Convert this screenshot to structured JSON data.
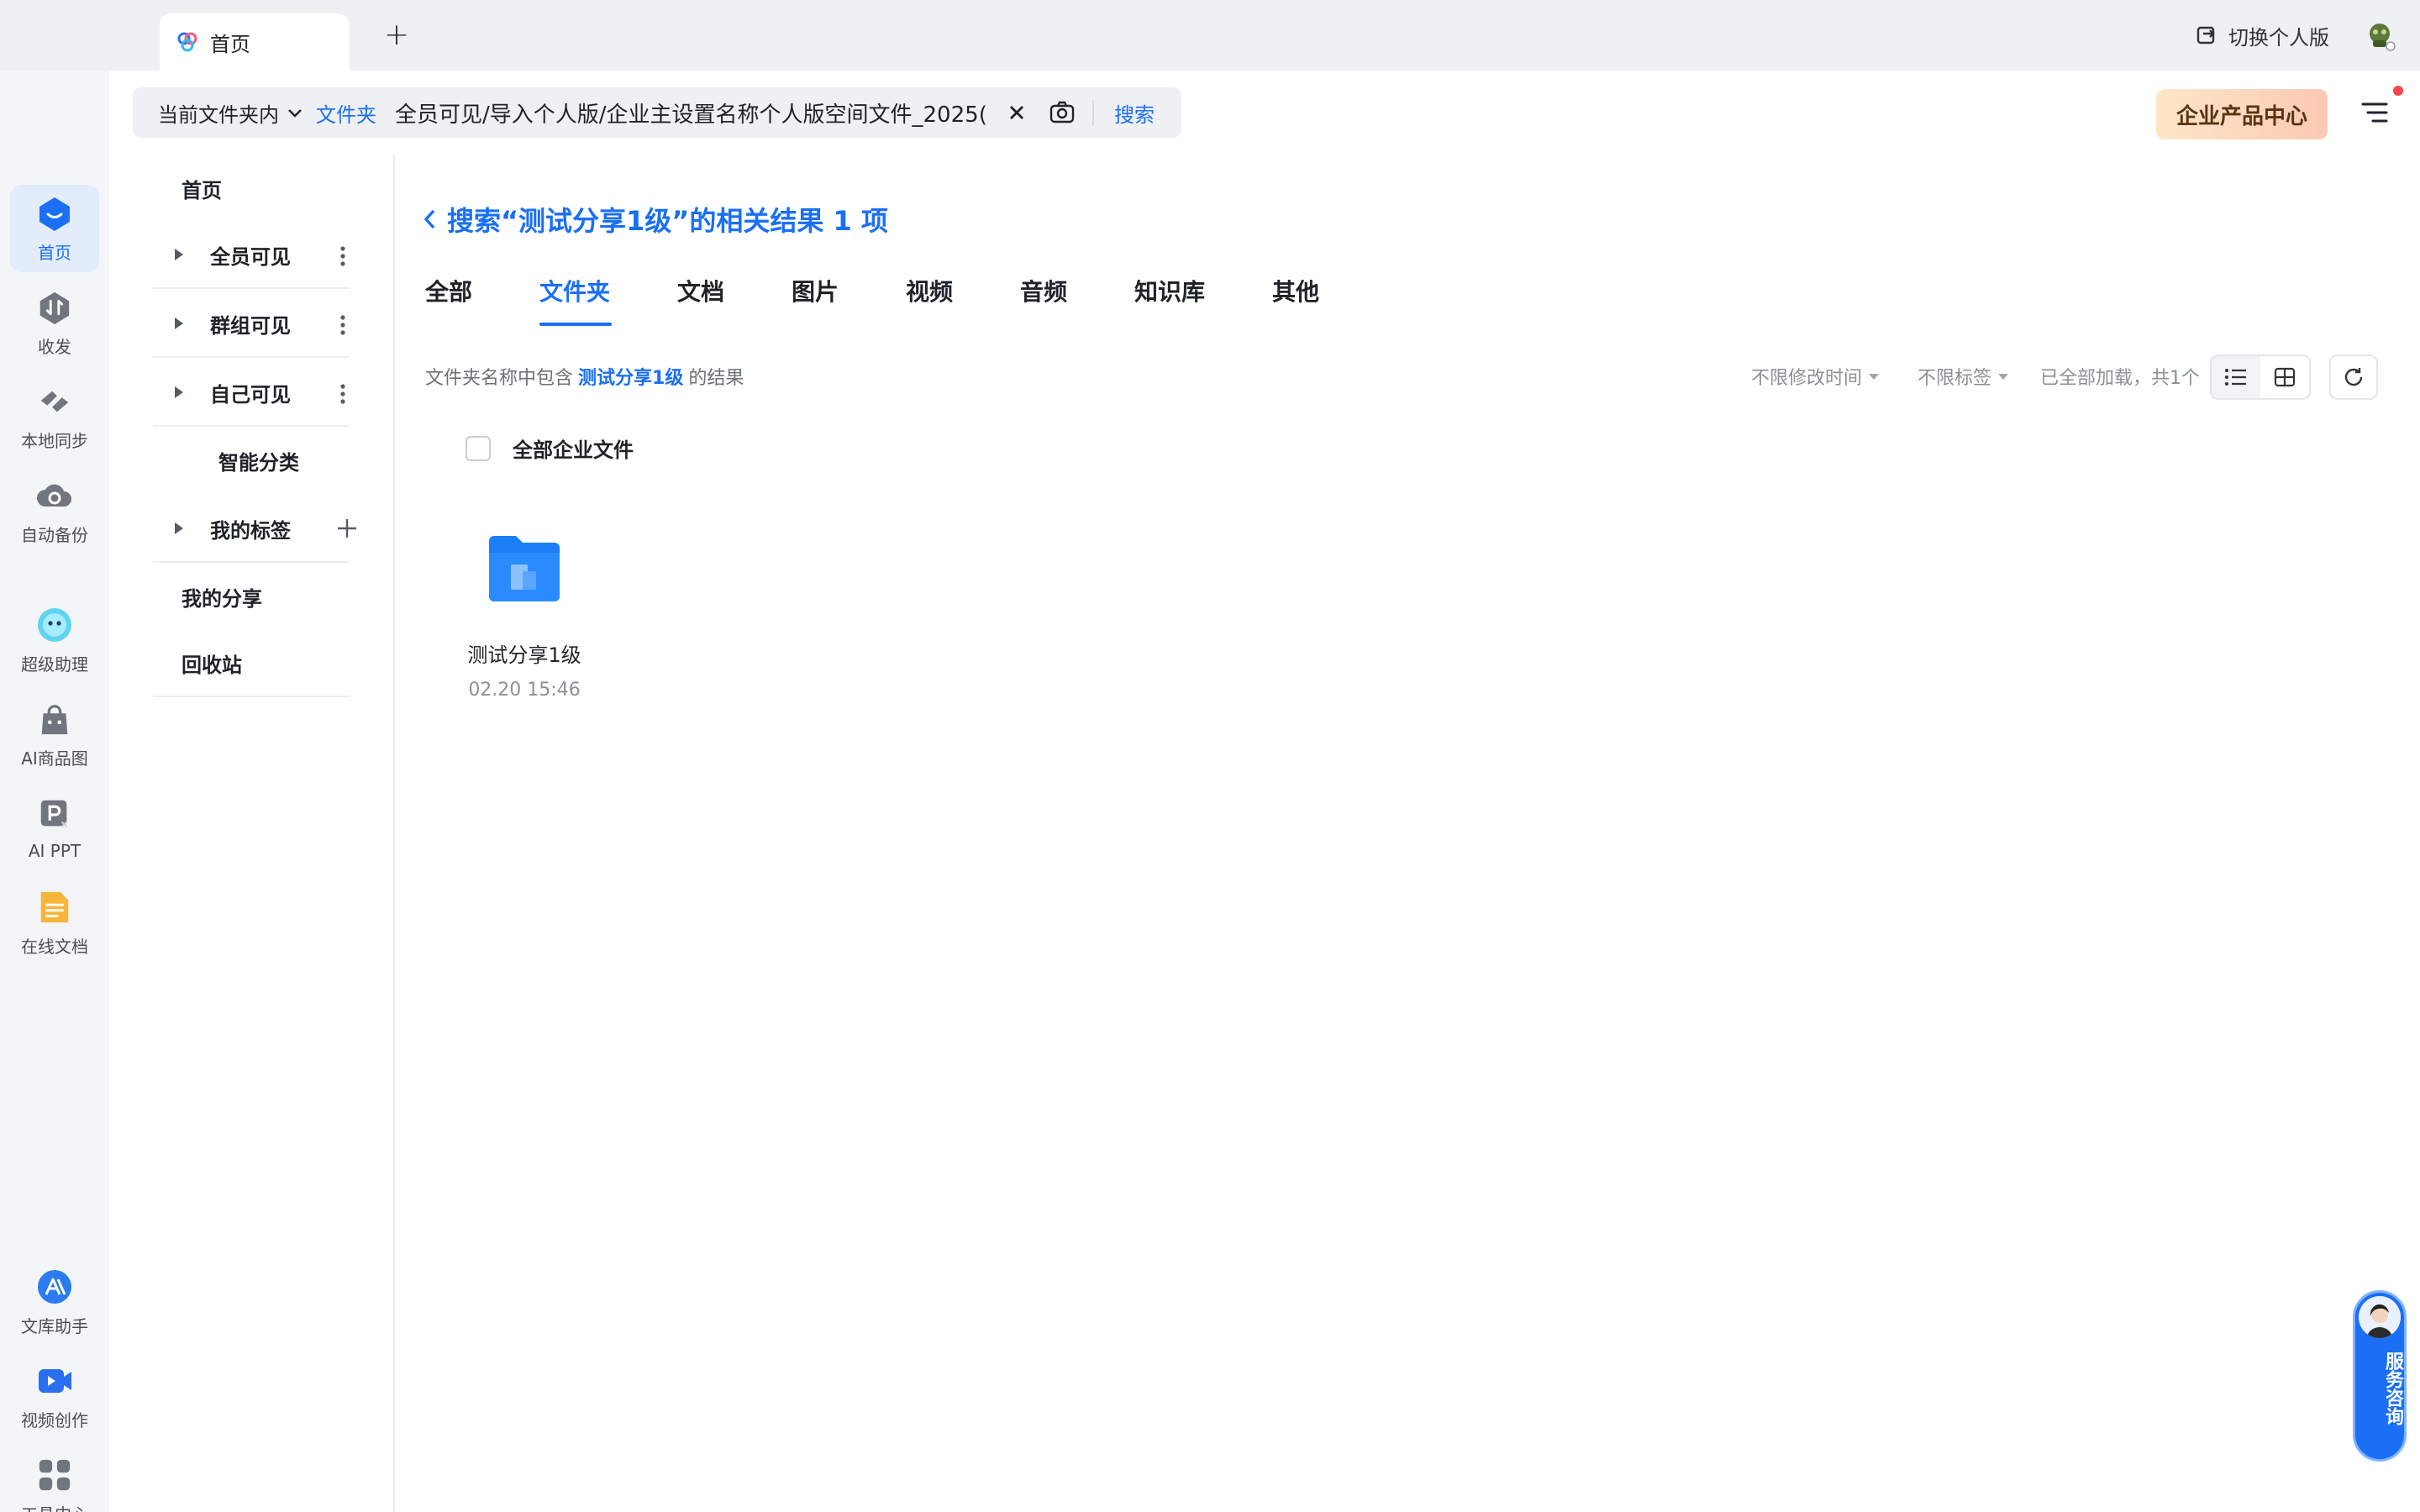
{
  "window": {
    "tab_label": "首页",
    "new_tab_symbol": "+",
    "switch_personal_label": "切换个人版"
  },
  "rail": {
    "top_items": [
      {
        "label": "首页",
        "icon": "home-icon",
        "active": true
      },
      {
        "label": "收发",
        "icon": "transfer-icon"
      },
      {
        "label": "本地同步",
        "icon": "sync-icon"
      },
      {
        "label": "自动备份",
        "icon": "backup-icon"
      },
      {
        "label": "超级助理",
        "icon": "assistant-icon"
      },
      {
        "label": "AI商品图",
        "icon": "ai-product-icon"
      },
      {
        "label": "AI PPT",
        "icon": "ai-ppt-icon"
      },
      {
        "label": "在线文档",
        "icon": "online-doc-icon"
      }
    ],
    "bottom_items": [
      {
        "label": "文库助手",
        "icon": "library-assistant-icon"
      },
      {
        "label": "视频创作",
        "icon": "video-create-icon"
      },
      {
        "label": "工具中心",
        "icon": "tools-icon"
      }
    ]
  },
  "search": {
    "scope_label": "当前文件夹内",
    "folder_chip": "文件夹",
    "path_value": "全员可见/导入个人版/企业主设置名称个人版空间文件_2025(",
    "button_label": "搜索"
  },
  "header": {
    "enterprise_label": "企业产品中心"
  },
  "subnav": {
    "items": [
      {
        "label": "首页"
      },
      {
        "label": "全员可见"
      },
      {
        "label": "群组可见"
      },
      {
        "label": "自己可见"
      },
      {
        "label": "智能分类"
      },
      {
        "label": "我的标签"
      },
      {
        "label": "我的分享"
      },
      {
        "label": "回收站"
      }
    ]
  },
  "main": {
    "back_title": "搜索“测试分享1级”的相关结果 1 项",
    "tabs": [
      {
        "label": "全部"
      },
      {
        "label": "文件夹",
        "active": true
      },
      {
        "label": "文档"
      },
      {
        "label": "图片"
      },
      {
        "label": "视频"
      },
      {
        "label": "音频"
      },
      {
        "label": "知识库"
      },
      {
        "label": "其他"
      }
    ],
    "summary_prefix": "文件夹名称中包含",
    "summary_keyword": "测试分享1级",
    "summary_suffix": "的结果",
    "filter_time": "不限修改时间",
    "filter_tag": "不限标签",
    "count_text": "已全部加载，共1个",
    "select_all_label": "全部企业文件",
    "files": [
      {
        "name": "测试分享1级",
        "date": "02.20 15:46",
        "icon": "folder-icon"
      }
    ]
  },
  "service": {
    "label": "服务咨询"
  },
  "colors": {
    "accent": "#1a6ff5",
    "rail_bg": "#f3f5f8",
    "titlebar_bg": "#eef0f3",
    "notify_dot": "#f5464b"
  }
}
